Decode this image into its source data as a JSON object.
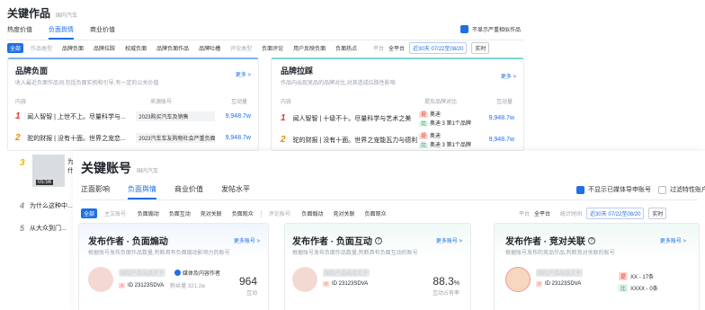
{
  "back": {
    "title": "关键作品",
    "subtitle": "国内汽车",
    "tabs": [
      "热度价值",
      "负面舆情",
      "商业价值"
    ],
    "active_tab": 1,
    "checkbox_label": "不显示严重相似作品",
    "filter_chips": [
      "全部",
      "",
      "品牌负面",
      "品牌拉踩",
      "权威负面",
      "品牌负面作品",
      "品牌吐槽",
      "",
      "负面评论",
      "用户反映负面",
      "负面热点"
    ],
    "period_label": "平台",
    "platform_value": "全平台",
    "date_value": "近30天 07/22至08/20",
    "refresh_label": "实时",
    "card1": {
      "title": "品牌负面",
      "desc": "收入最近负面作品词,包括负面实例和引导,有一定的公关价值",
      "more": "更多 >",
      "col1": "内容",
      "col2": "来源账号",
      "col3": "互动量",
      "rows": [
        {
          "rank": "1",
          "text": "闻人智智 | 上世不上。尽量科学与...",
          "source": "2023购买汽车及销售",
          "value": "9,948.7w"
        },
        {
          "rank": "2",
          "text": "驼的财报 | 没有十面。世界之宠恋...",
          "source": "2023汽车车友购物社会严重负面...",
          "value": "9,948.7w"
        }
      ]
    },
    "card2": {
      "title": "品牌拉踩",
      "desc": "作品内出现竞品的品牌对比,对其造成拉踩性影响",
      "more": "更多 >",
      "col1": "内容",
      "col2": "提及品牌对比",
      "col3": "互动量",
      "rows": [
        {
          "rank": "1",
          "text": "闻人智智 | 十级不十。尽量科学与艺术之美",
          "b1": "奥迪",
          "b2": "奥迪 3 第1个品牌",
          "value": "9,948.7w"
        },
        {
          "rank": "2",
          "text": "驼的财报 | 没有十面。世界之宠能瓦力与德利",
          "b1": "奥迪",
          "b2": "奥迪 3 第1个品牌",
          "value": "9,948.7w"
        }
      ]
    },
    "list_rows": [
      {
        "rank": "3",
        "text": "为什",
        "sub": "视频",
        "dur": "05:56"
      },
      {
        "rank": "4",
        "text": "为什么这种中..."
      },
      {
        "rank": "5",
        "text": "从大众到门..."
      }
    ]
  },
  "front": {
    "title": "关键账号",
    "subtitle": "国内汽车",
    "tabs": [
      "正面影响",
      "负面舆情",
      "商业价值",
      "发帖水平"
    ],
    "active_tab": 1,
    "check1": "不显示已媒体导申账号",
    "check2": "过滤特性账户",
    "chips_left_label": "主文账号:",
    "chips_a": [
      "全部",
      "负面煽动",
      "负面互动",
      "竞对关联",
      "负面观众"
    ],
    "chips_mid_label": "评论账号:",
    "chips_b": [
      "负面煽动",
      "竞对关联",
      "负面观众"
    ],
    "platform_label": "平台",
    "platform_value": "全平台",
    "time_label": "统计时间",
    "date_value": "近30天 07/22至08/20",
    "refresh_label": "实时",
    "cards": [
      {
        "title": "发布作者 · 负面煽动",
        "more": "更多账号 >",
        "desc": "根据账号发布负面作品数量,判断具有负面煽动影响力的账号",
        "name_blur": "国际产品出品大于",
        "verified": "媒体及内容作者",
        "id_text": "ID 23123SDVA",
        "fans": "粉丝量 321.2w",
        "big_value": "964",
        "big_label": "互动"
      },
      {
        "title": "发布作者 · 负面互动",
        "more": "更多账号 >",
        "desc": "根据账号发布负面作品数量,判断具有负面互动的账号",
        "name_blur": "国际产品出品大于",
        "id_text": "ID 23123SDVA",
        "big_value": "88.3",
        "big_unit": "%",
        "big_label": "互动占有率"
      },
      {
        "title": "发布作者 · 竞对关联",
        "more": "更多账号 >",
        "desc": "根据账号发布的竞品作品,判断竞对关联的账号",
        "name_blur": "国际产品出品大于",
        "id_text": "ID 23123SDVA",
        "rel1": "XX - 17条",
        "rel2": "XXXX - 0条"
      }
    ]
  },
  "colors": {
    "accent": "#1f6fe5",
    "rank1": "#e2382b",
    "rank2": "#f08c00"
  }
}
